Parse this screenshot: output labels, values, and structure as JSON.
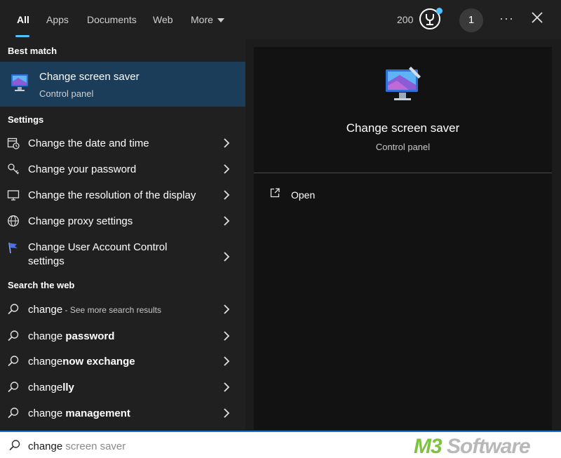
{
  "tabs": [
    {
      "label": "All",
      "active": true
    },
    {
      "label": "Apps"
    },
    {
      "label": "Documents"
    },
    {
      "label": "Web"
    },
    {
      "label": "More"
    }
  ],
  "header": {
    "points": "200",
    "account_initial": "1",
    "more_options": "···"
  },
  "best_match": {
    "section_title": "Best match",
    "title": "Change screen saver",
    "subtitle": "Control panel"
  },
  "settings": {
    "section_title": "Settings",
    "items": [
      {
        "label": "Change the date and time",
        "icon": "calendar-clock-icon"
      },
      {
        "label": "Change your password",
        "icon": "key-icon"
      },
      {
        "label": "Change the resolution of the display",
        "icon": "monitor-icon"
      },
      {
        "label": "Change proxy settings",
        "icon": "globe-icon"
      },
      {
        "label": "Change User Account Control settings",
        "icon": "flag-icon"
      }
    ]
  },
  "web": {
    "section_title": "Search the web",
    "items": [
      {
        "prefix": "change",
        "bold": "",
        "extra": " - See more search results"
      },
      {
        "prefix": "change ",
        "bold": "password",
        "extra": ""
      },
      {
        "prefix": "change",
        "bold": "now exchange",
        "extra": ""
      },
      {
        "prefix": "change",
        "bold": "lly",
        "extra": ""
      },
      {
        "prefix": "change ",
        "bold": "management",
        "extra": ""
      }
    ]
  },
  "preview": {
    "title": "Change screen saver",
    "subtitle": "Control panel",
    "actions": [
      {
        "label": "Open",
        "icon": "open-external-icon"
      }
    ]
  },
  "search": {
    "typed": "change",
    "suggestion": " screen saver"
  },
  "watermark": {
    "m3": "M3",
    "software": " Software"
  },
  "colors": {
    "accent": "#4cc2ff",
    "selection": "#1c3d5a",
    "watermark_green": "#7fc241"
  }
}
